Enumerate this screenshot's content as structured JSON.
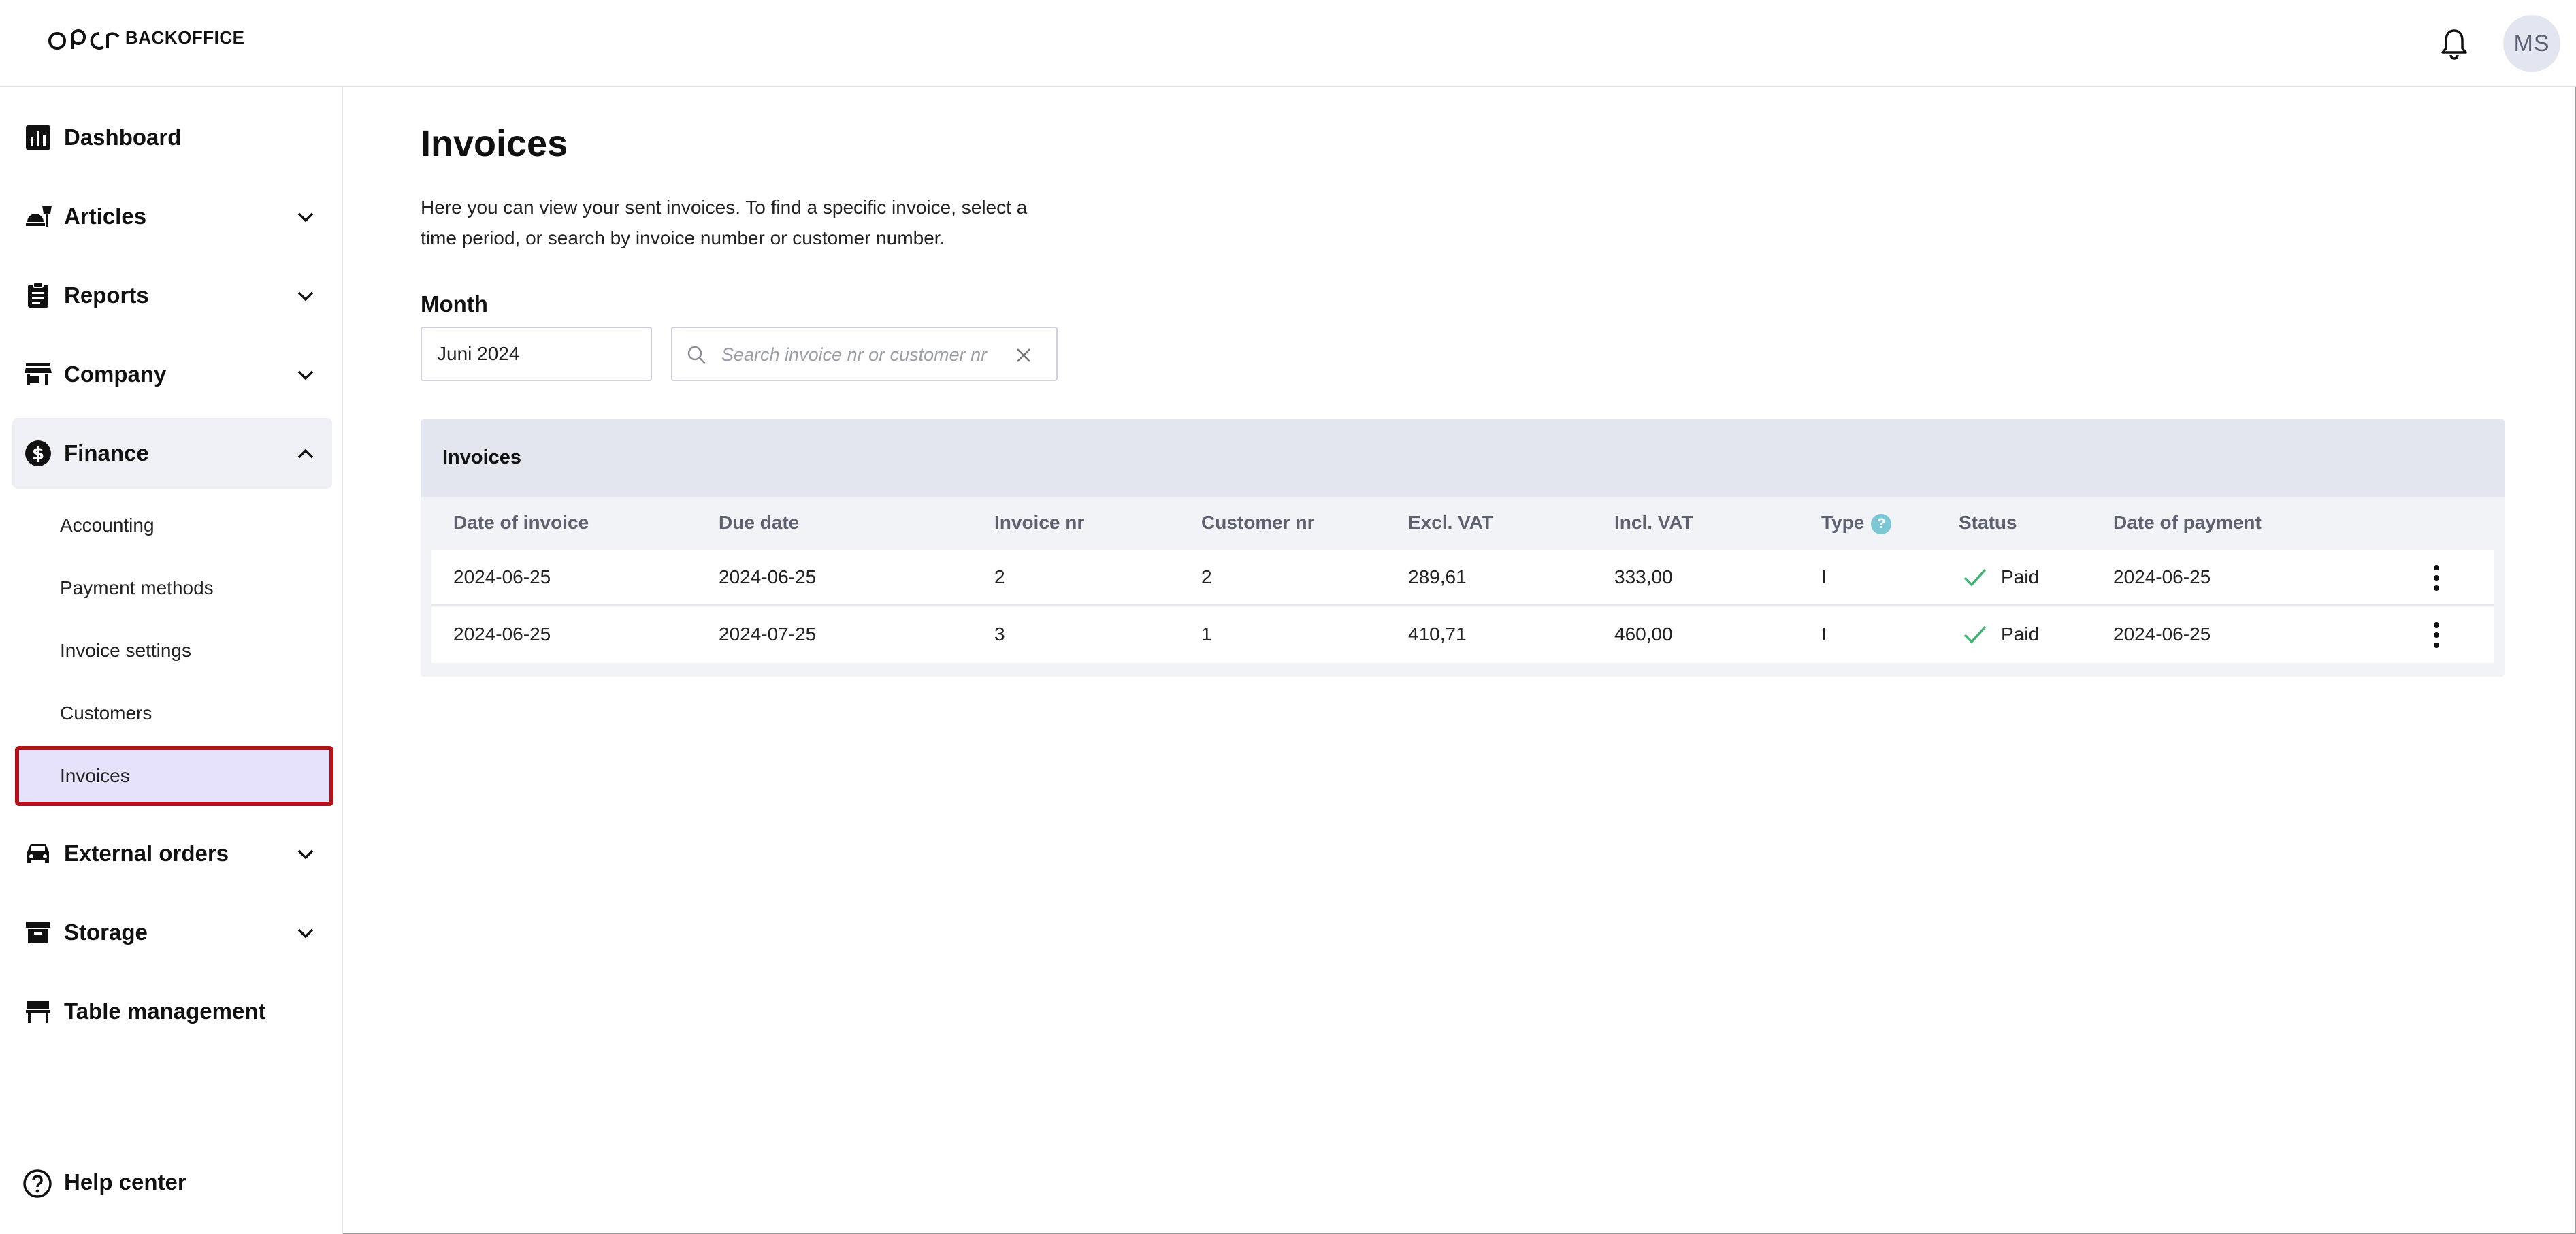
{
  "header": {
    "logo_mark": "OPEN",
    "logo_text": "BACKOFFICE",
    "avatar_initials": "MS"
  },
  "sidebar": {
    "items": [
      {
        "label": "Dashboard",
        "icon": "dashboard-icon"
      },
      {
        "label": "Articles",
        "icon": "articles-icon"
      },
      {
        "label": "Reports",
        "icon": "reports-icon"
      },
      {
        "label": "Company",
        "icon": "store-icon"
      },
      {
        "label": "Finance",
        "icon": "dollar-icon"
      },
      {
        "label": "External orders",
        "icon": "car-icon"
      },
      {
        "label": "Storage",
        "icon": "archive-icon"
      },
      {
        "label": "Table management",
        "icon": "table-icon"
      }
    ],
    "finance_sub": [
      {
        "label": "Accounting"
      },
      {
        "label": "Payment methods"
      },
      {
        "label": "Invoice settings"
      },
      {
        "label": "Customers"
      },
      {
        "label": "Invoices"
      }
    ],
    "help_label": "Help center"
  },
  "main": {
    "title": "Invoices",
    "description": "Here you can view your sent invoices. To find a specific invoice, select a time period, or search by invoice number or customer number.",
    "month_label": "Month",
    "month_value": "Juni 2024",
    "search_placeholder": "Search invoice nr or customer nr",
    "panel_title": "Invoices",
    "columns": [
      "Date of invoice",
      "Due date",
      "Invoice nr",
      "Customer nr",
      "Excl. VAT",
      "Incl. VAT",
      "Type",
      "Status",
      "Date of payment"
    ],
    "type_help": "?",
    "rows": [
      {
        "date": "2024-06-25",
        "due": "2024-06-25",
        "invoice_nr": "2",
        "customer_nr": "2",
        "excl": "289,61",
        "incl": "333,00",
        "type": "I",
        "status": "Paid",
        "payment_date": "2024-06-25"
      },
      {
        "date": "2024-06-25",
        "due": "2024-07-25",
        "invoice_nr": "3",
        "customer_nr": "1",
        "excl": "410,71",
        "incl": "460,00",
        "type": "I",
        "status": "Paid",
        "payment_date": "2024-06-25"
      }
    ]
  },
  "colors": {
    "active_bg": "#e6e2fb",
    "active_border": "#b1121c",
    "paid_check": "#3cb371",
    "panel_head": "#e3e6ef"
  }
}
